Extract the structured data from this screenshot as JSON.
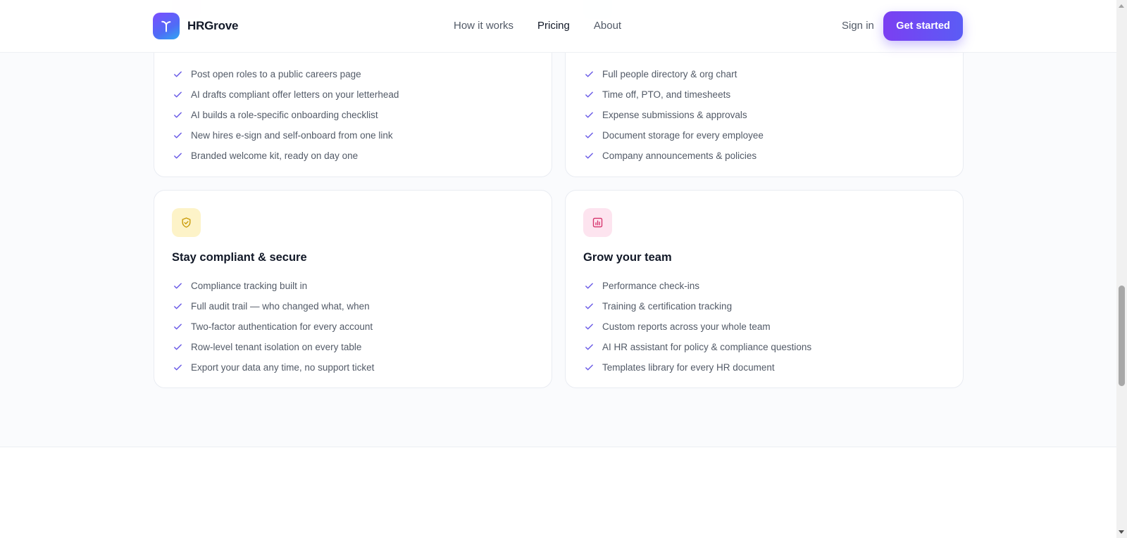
{
  "header": {
    "brand_name": "HRGrove",
    "nav": [
      {
        "label": "How it works"
      },
      {
        "label": "Pricing"
      },
      {
        "label": "About"
      }
    ],
    "sign_in": "Sign in",
    "cta": "Get started"
  },
  "cards": [
    {
      "items": [
        "Post open roles to a public careers page",
        "AI drafts compliant offer letters on your letterhead",
        "AI builds a role-specific onboarding checklist",
        "New hires e-sign and self-onboard from one link",
        "Branded welcome kit, ready on day one"
      ]
    },
    {
      "items": [
        "Full people directory & org chart",
        "Time off, PTO, and timesheets",
        "Expense submissions & approvals",
        "Document storage for every employee",
        "Company announcements & policies"
      ]
    },
    {
      "title": "Stay compliant & secure",
      "icon": "shield-check-icon",
      "icon_color": "#c99a06",
      "items": [
        "Compliance tracking built in",
        "Full audit trail — who changed what, when",
        "Two-factor authentication for every account",
        "Row-level tenant isolation on every table",
        "Export your data any time, no support ticket"
      ]
    },
    {
      "title": "Grow your team",
      "icon": "bar-chart-icon",
      "icon_color": "#d6336c",
      "items": [
        "Performance check-ins",
        "Training & certification tracking",
        "Custom reports across your whole team",
        "AI HR assistant for policy & compliance questions",
        "Templates library for every HR document"
      ]
    }
  ],
  "colors": {
    "accent": "#6d4cf5",
    "check": "#6b5ce7"
  }
}
